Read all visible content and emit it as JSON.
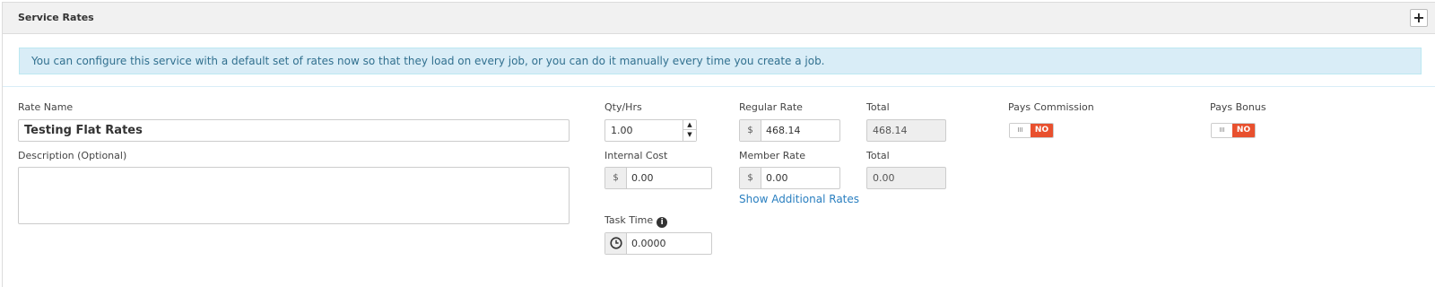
{
  "panel": {
    "title": "Service Rates",
    "add_label": "+"
  },
  "info": "You can configure this service with a default set of rates now so that they load on every job, or you can do it manually every time you create a job.",
  "form": {
    "rate_name": {
      "label": "Rate Name",
      "value": "Testing Flat Rates"
    },
    "description": {
      "label": "Description (Optional)",
      "value": ""
    },
    "qty": {
      "label": "Qty/Hrs",
      "value": "1.00",
      "up": "▲",
      "down": "▼"
    },
    "internal_cost": {
      "label": "Internal Cost",
      "currency": "$",
      "value": "0.00"
    },
    "task_time": {
      "label": "Task Time",
      "info_glyph": "i",
      "value": "0.0000"
    },
    "regular_rate": {
      "label": "Regular Rate",
      "currency": "$",
      "value": "468.14"
    },
    "member_rate": {
      "label": "Member Rate",
      "currency": "$",
      "value": "0.00"
    },
    "show_additional": "Show Additional Rates",
    "total1": {
      "label": "Total",
      "value": "468.14"
    },
    "total2": {
      "label": "Total",
      "value": "0.00"
    },
    "pays_commission": {
      "label": "Pays Commission",
      "off": "III",
      "state": "NO"
    },
    "pays_bonus": {
      "label": "Pays Bonus",
      "off": "III",
      "state": "NO"
    }
  },
  "colors": {
    "toggle_no": "#e8502e",
    "link": "#2a7fc0",
    "info_bg": "#d9edf7"
  },
  "icons": {
    "clock": "clock-icon",
    "info": "info-icon"
  }
}
